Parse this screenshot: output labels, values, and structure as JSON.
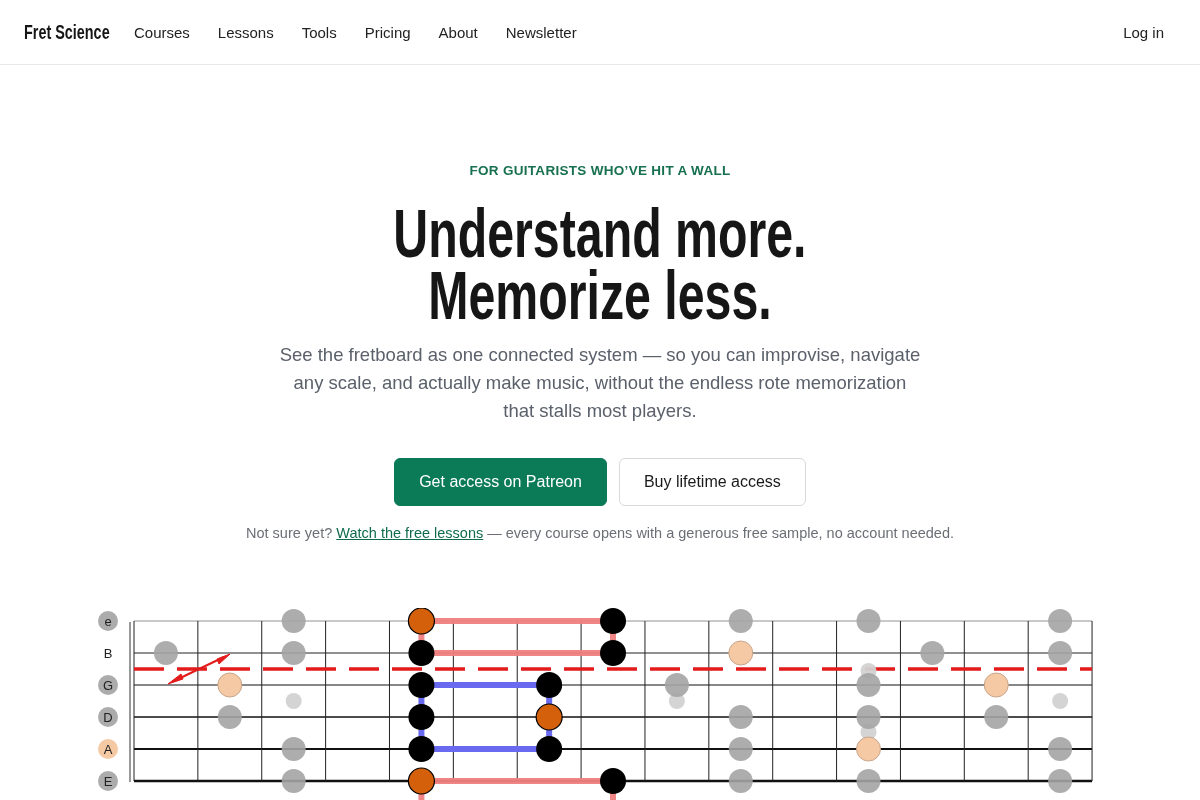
{
  "nav": {
    "logo": "Fret Science",
    "links": [
      "Courses",
      "Lessons",
      "Tools",
      "Pricing",
      "About",
      "Newsletter"
    ],
    "login": "Log in"
  },
  "hero": {
    "eyebrow": "FOR GUITARISTS WHO’VE HIT A WALL",
    "headline": [
      "Understand more.",
      "Memorize less."
    ],
    "intro": "See the fretboard as one connected system — so you can improvise, navigate any scale, and actually make music, without the endless rote memorization that stalls most players.",
    "buttons": [
      {
        "label": "Get access on Patreon",
        "kind": "primary"
      },
      {
        "label": "Buy lifetime access",
        "kind": "secondary"
      }
    ],
    "note": {
      "before": "Not sure yet?",
      "link": "Watch the free lessons",
      "after": "— every course opens with a generous free sample, no account needed."
    }
  },
  "fretboard": {
    "string_labels": [
      {
        "label": "e",
        "color": "#acacac"
      },
      {
        "label": "B"
      },
      {
        "label": "G",
        "color": "#acacac"
      },
      {
        "label": "D",
        "color": "#acacac"
      },
      {
        "label": "A",
        "color": "#f5c9a4"
      },
      {
        "label": "E",
        "color": "#acacac"
      }
    ]
  }
}
